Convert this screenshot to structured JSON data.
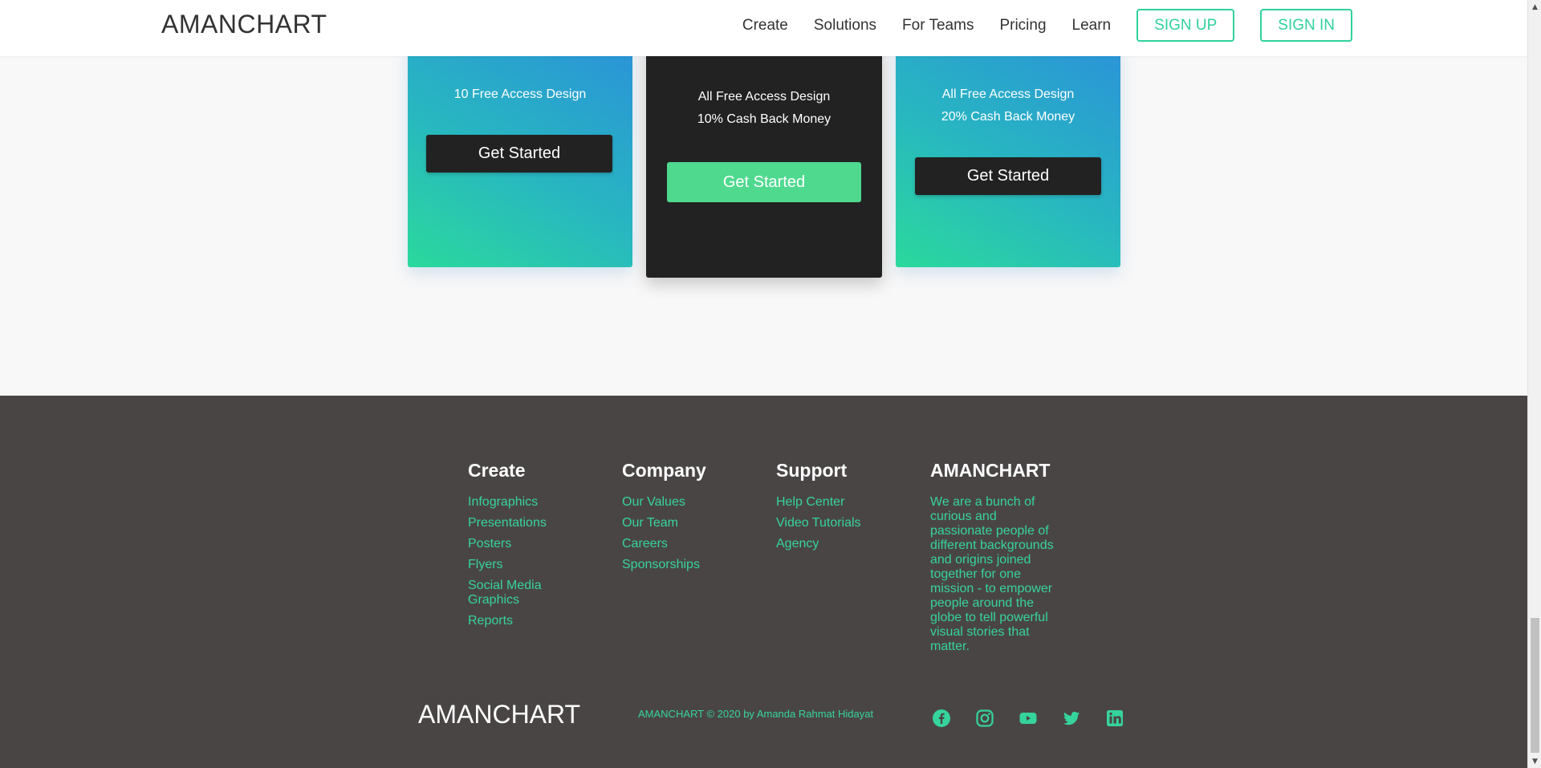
{
  "header": {
    "logo": "AMANCHART",
    "nav": [
      "Create",
      "Solutions",
      "For Teams",
      "Pricing",
      "Learn"
    ],
    "signup": "SIGN UP",
    "signin": "SIGN IN"
  },
  "pricing": {
    "cards": [
      {
        "features": [
          "10 Free Access Design"
        ],
        "button": "Get Started"
      },
      {
        "features": [
          "All Free Access Design",
          "10% Cash Back Money"
        ],
        "button": "Get Started"
      },
      {
        "features": [
          "All Free Access Design",
          "20% Cash Back Money"
        ],
        "button": "Get Started"
      }
    ]
  },
  "footer": {
    "create": {
      "title": "Create",
      "links": [
        "Infographics",
        "Presentations",
        "Posters",
        "Flyers",
        "Social Media Graphics",
        "Reports"
      ]
    },
    "company": {
      "title": "Company",
      "links": [
        "Our Values",
        "Our Team",
        "Careers",
        "Sponsorships"
      ]
    },
    "support": {
      "title": "Support",
      "links": [
        "Help Center",
        "Video Tutorials",
        "Agency"
      ]
    },
    "about": {
      "title": "AMANCHART",
      "text": "We are a bunch of curious and passionate people of different backgrounds and origins joined together for one mission - to empower people around the globe to tell powerful visual stories that matter."
    },
    "logo": "AMANCHART",
    "copyright": "AMANCHART © 2020 by Amanda Rahmat Hidayat",
    "socials": [
      "facebook-icon",
      "instagram-icon",
      "youtube-icon",
      "twitter-icon",
      "linkedin-icon"
    ]
  },
  "colors": {
    "accent": "#2fd29a",
    "footer_bg": "#4a4545",
    "dark_card": "#222222"
  }
}
